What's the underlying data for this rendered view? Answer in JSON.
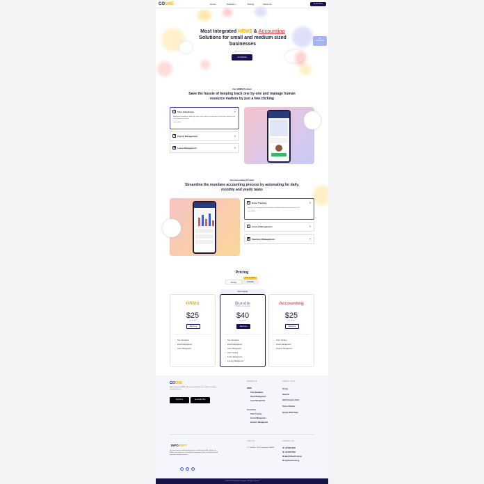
{
  "nav": {
    "logo_prefix": "CO",
    "logo_suffix": "SME",
    "links": [
      "Home",
      "Products",
      "Pricing",
      "About Us"
    ],
    "cta": "Try For Free"
  },
  "hero": {
    "title_1": "Most Integrated ",
    "title_hrms": "HRMS",
    "title_2": " & ",
    "title_accounting": "Accounting",
    "title_3": " Solutions for small and medium sized businesses",
    "subtitle": "Sign up free for 30 days",
    "cta": "Get Started",
    "widget": "Contact Us"
  },
  "hrms_section": {
    "kicker": "Our HRMS Product",
    "title": "Save the hassle of keeping track one by one and manage human resource matters by just a few clicking",
    "items": [
      {
        "label": "Time Attendance",
        "icon": "clock-icon",
        "open": true,
        "body": "Employees attendance taken by phone, with selfies for verification, tracked for overtime, late and absences instantly.",
        "link": "Learn More"
      },
      {
        "label": "Payroll Management",
        "icon": "wallet-icon",
        "open": false
      },
      {
        "label": "Leave Management",
        "icon": "calendar-icon",
        "open": false
      }
    ]
  },
  "accounting_section": {
    "kicker": "Our Accounting Product",
    "title": "Streamline the mundane accounting process by automating for daily, monthly and yearly tasks",
    "items": [
      {
        "label": "Order Tracking",
        "icon": "cart-icon",
        "open": true,
        "body": "Manage all incoming purchase orders & transform into invoices with one click.",
        "link": "Learn More"
      },
      {
        "label": "Invoice Management",
        "icon": "invoice-icon",
        "open": false
      },
      {
        "label": "Inventory Management",
        "icon": "box-icon",
        "open": false
      }
    ]
  },
  "pricing": {
    "title": "Pricing",
    "monthly": "Monthly",
    "annually": "Annually",
    "badge": "Save up to 20%",
    "popular": "Most Popular",
    "plans": [
      {
        "name": "HRMS",
        "color": "#f0b400",
        "price": "$25",
        "per": "per month",
        "cta": "Start Free",
        "features": [
          "Time Attendance",
          "Payroll Management",
          "Leave Management"
        ]
      },
      {
        "name": "Bundle",
        "subtitle": "(HRMS + Accounting)",
        "color": "#8aa0e6",
        "price": "$40",
        "per": "per month",
        "cta": "Start Free",
        "features": [
          "Time Attendance",
          "Payroll Management",
          "Leave Management",
          "Order Tracking",
          "Invoice Management",
          "Inventory Management"
        ]
      },
      {
        "name": "Accounting",
        "color": "#e45454",
        "price": "$25",
        "per": "per month",
        "cta": "Start Free",
        "features": [
          "Order Tracking",
          "Invoice Management",
          "Inventory Management"
        ]
      }
    ]
  },
  "footer": {
    "about": "Most Integrated HRMS & Accounting Solutions for small and medium sized businesses.",
    "app_store": "App Store",
    "google_play": "Google Play",
    "products_head": "PRODUCTS",
    "hrms": "HRMS",
    "hrms_items": [
      "Time Attendance",
      "Payroll Management",
      "Leave Management"
    ],
    "accounting": "Accounting",
    "accounting_items": [
      "Order Tracking",
      "Invoice Management",
      "Inventory Management"
    ],
    "useful_head": "USEFUL LINKS",
    "useful_items": [
      "Pricing",
      "About Us",
      "Data Protection Policy",
      "Terms of Service",
      "Security White Paper"
    ],
    "infosoft_prefix": "INFO",
    "infosoft_suffix": "SOFT",
    "infosoft_text": "We have been providing professional accounting and HR solutions to SMEs, from start-ups to established companies, with our dedicated and experienced professionals.",
    "visit_head": "VISIT US",
    "address": "73 Ubi Ave, #06-06 Singapore 408936",
    "contact_head": "CONTACT US",
    "phone_1": "+65 6000 0000",
    "phone_2": "+65 9000 0000",
    "email_1": "sales@infosoft.com.sg",
    "email_2": "hr@infosoft.com.sg",
    "copyright": "© 2022 Info Soft Systems Singapore. All rights reserved."
  }
}
